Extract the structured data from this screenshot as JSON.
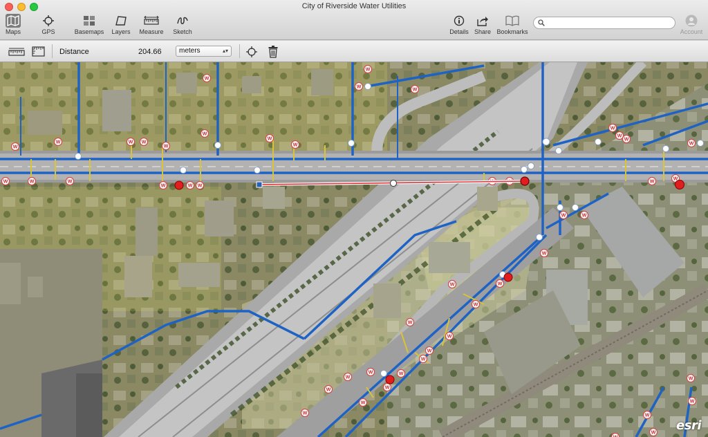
{
  "window": {
    "title": "City of Riverside Water Utilities"
  },
  "toolbar": {
    "maps": "Maps",
    "gps": "GPS",
    "basemaps": "Basemaps",
    "layers": "Layers",
    "measure": "Measure",
    "sketch": "Sketch",
    "details": "Details",
    "share": "Share",
    "bookmarks": "Bookmarks",
    "account": "Account"
  },
  "search": {
    "placeholder": "",
    "value": ""
  },
  "measure_bar": {
    "mode_label": "Distance",
    "value": "204.66",
    "unit": "meters"
  },
  "map": {
    "attribution": "esri",
    "hydrant_label": "W",
    "colors": {
      "water_main": "#1e63c4",
      "service_line": "#d8c43a",
      "measure_line": "#e0303a",
      "valve": "#e01e1e"
    }
  },
  "icons": {
    "maps": "map-icon",
    "gps": "crosshair-icon",
    "basemaps": "grid-icon",
    "layers": "layers-icon",
    "measure": "ruler-icon",
    "sketch": "sketch-icon",
    "details": "info-icon",
    "share": "share-icon",
    "bookmarks": "book-icon",
    "account": "account-icon"
  }
}
